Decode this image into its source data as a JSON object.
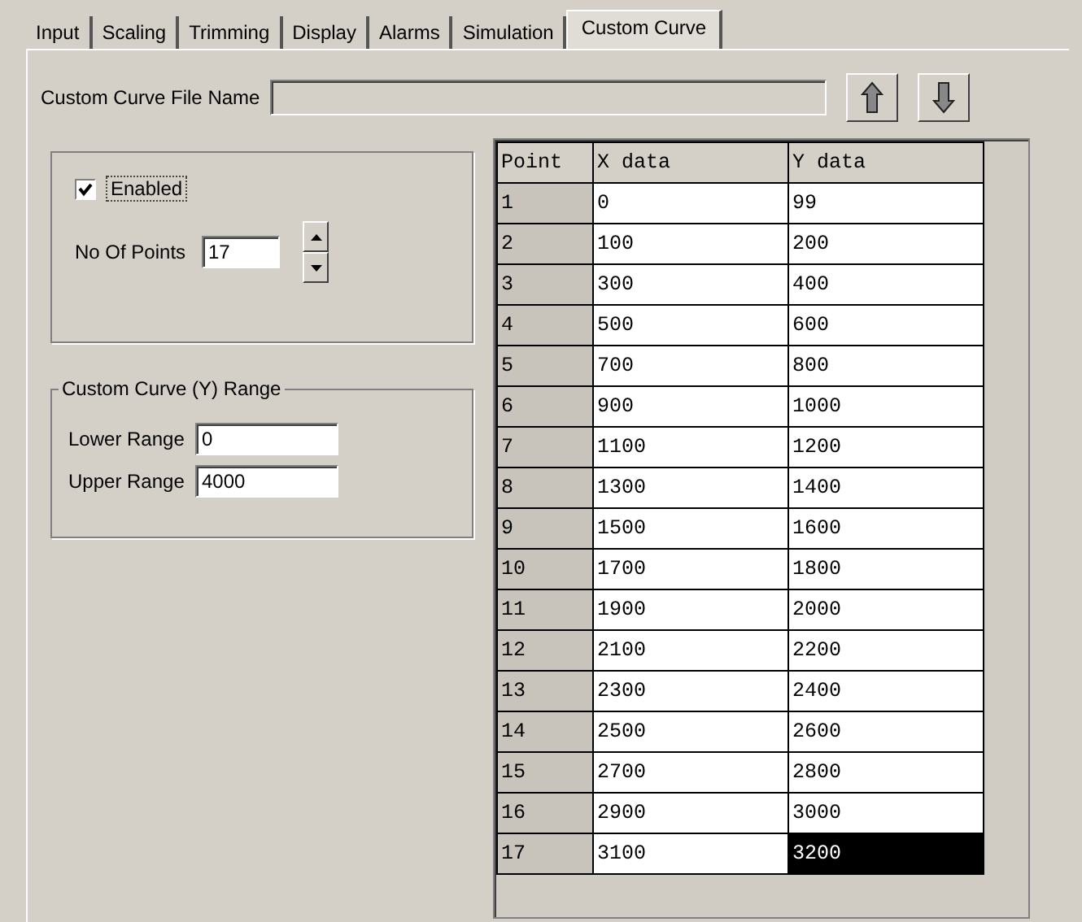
{
  "tabs": [
    {
      "label": "Input",
      "selected": false
    },
    {
      "label": "Scaling",
      "selected": false
    },
    {
      "label": "Trimming",
      "selected": false
    },
    {
      "label": "Display",
      "selected": false
    },
    {
      "label": "Alarms",
      "selected": false
    },
    {
      "label": "Simulation",
      "selected": false
    },
    {
      "label": "Custom Curve",
      "selected": true
    }
  ],
  "file_name": {
    "label": "Custom Curve File Name"
  },
  "enabled": {
    "label": "Enabled",
    "checked": true
  },
  "points": {
    "label": "No Of Points",
    "value": "17"
  },
  "range_group": {
    "title": "Custom Curve (Y) Range",
    "lower_label": "Lower Range",
    "lower_value": "0",
    "upper_label": "Upper Range",
    "upper_value": "4000"
  },
  "table": {
    "columns": [
      "Point",
      "X data",
      "Y data"
    ],
    "rows": [
      {
        "cells": [
          {
            "text": "1",
            "selected": false
          },
          {
            "text": "0",
            "selected": false
          },
          {
            "text": "99",
            "selected": false
          }
        ]
      },
      {
        "cells": [
          {
            "text": "2",
            "selected": false
          },
          {
            "text": "100",
            "selected": false
          },
          {
            "text": "200",
            "selected": false
          }
        ]
      },
      {
        "cells": [
          {
            "text": "3",
            "selected": false
          },
          {
            "text": "300",
            "selected": false
          },
          {
            "text": "400",
            "selected": false
          }
        ]
      },
      {
        "cells": [
          {
            "text": "4",
            "selected": false
          },
          {
            "text": "500",
            "selected": false
          },
          {
            "text": "600",
            "selected": false
          }
        ]
      },
      {
        "cells": [
          {
            "text": "5",
            "selected": false
          },
          {
            "text": "700",
            "selected": false
          },
          {
            "text": "800",
            "selected": false
          }
        ]
      },
      {
        "cells": [
          {
            "text": "6",
            "selected": false
          },
          {
            "text": "900",
            "selected": false
          },
          {
            "text": "1000",
            "selected": false
          }
        ]
      },
      {
        "cells": [
          {
            "text": "7",
            "selected": false
          },
          {
            "text": "1100",
            "selected": false
          },
          {
            "text": "1200",
            "selected": false
          }
        ]
      },
      {
        "cells": [
          {
            "text": "8",
            "selected": false
          },
          {
            "text": "1300",
            "selected": false
          },
          {
            "text": "1400",
            "selected": false
          }
        ]
      },
      {
        "cells": [
          {
            "text": "9",
            "selected": false
          },
          {
            "text": "1500",
            "selected": false
          },
          {
            "text": "1600",
            "selected": false
          }
        ]
      },
      {
        "cells": [
          {
            "text": "10",
            "selected": false
          },
          {
            "text": "1700",
            "selected": false
          },
          {
            "text": "1800",
            "selected": false
          }
        ]
      },
      {
        "cells": [
          {
            "text": "11",
            "selected": false
          },
          {
            "text": "1900",
            "selected": false
          },
          {
            "text": "2000",
            "selected": false
          }
        ]
      },
      {
        "cells": [
          {
            "text": "12",
            "selected": false
          },
          {
            "text": "2100",
            "selected": false
          },
          {
            "text": "2200",
            "selected": false
          }
        ]
      },
      {
        "cells": [
          {
            "text": "13",
            "selected": false
          },
          {
            "text": "2300",
            "selected": false
          },
          {
            "text": "2400",
            "selected": false
          }
        ]
      },
      {
        "cells": [
          {
            "text": "14",
            "selected": false
          },
          {
            "text": "2500",
            "selected": false
          },
          {
            "text": "2600",
            "selected": false
          }
        ]
      },
      {
        "cells": [
          {
            "text": "15",
            "selected": false
          },
          {
            "text": "2700",
            "selected": false
          },
          {
            "text": "2800",
            "selected": false
          }
        ]
      },
      {
        "cells": [
          {
            "text": "16",
            "selected": false
          },
          {
            "text": "2900",
            "selected": false
          },
          {
            "text": "3000",
            "selected": false
          }
        ]
      },
      {
        "cells": [
          {
            "text": "17",
            "selected": false
          },
          {
            "text": "3100",
            "selected": false
          },
          {
            "text": "3200",
            "selected": true
          }
        ]
      }
    ]
  }
}
